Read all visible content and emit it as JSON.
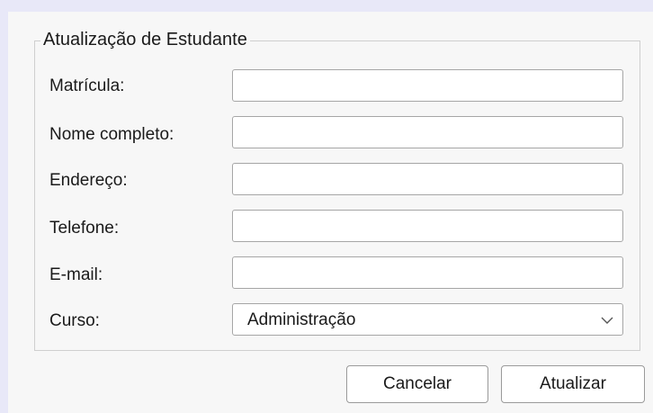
{
  "dialog": {
    "group_title": "Atualização de Estudante"
  },
  "form": {
    "fields": [
      {
        "label": "Matrícula:",
        "value": "",
        "placeholder": ""
      },
      {
        "label": "Nome completo:",
        "value": "",
        "placeholder": ""
      },
      {
        "label": "Endereço:",
        "value": "",
        "placeholder": ""
      },
      {
        "label": "Telefone:",
        "value": "",
        "placeholder": ""
      },
      {
        "label": "E-mail:",
        "value": "",
        "placeholder": ""
      }
    ],
    "course": {
      "label": "Curso:",
      "selected": "Administração",
      "icon": "chevron-down-icon"
    }
  },
  "buttons": {
    "cancel": "Cancelar",
    "update": "Atualizar"
  }
}
